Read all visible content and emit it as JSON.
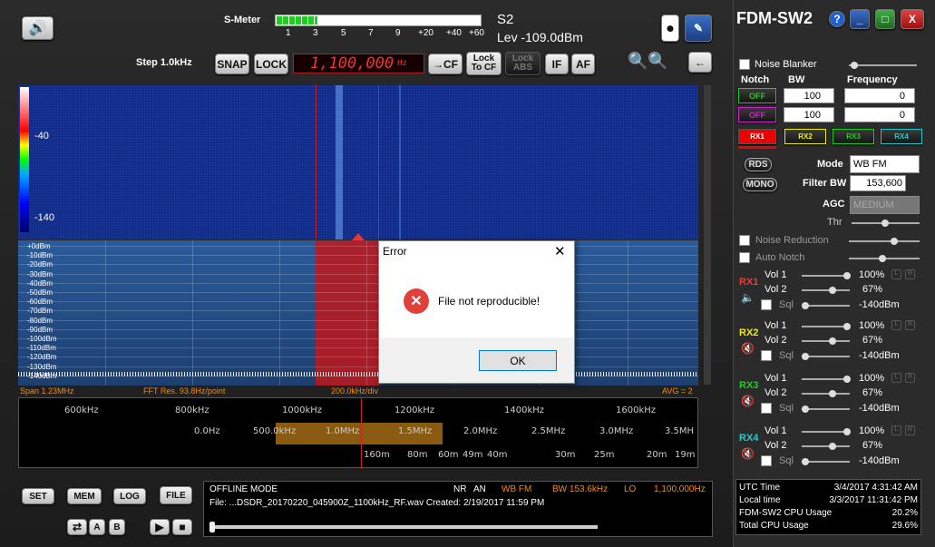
{
  "app": {
    "title": "FDM-SW2"
  },
  "smeter": {
    "label": "S-Meter",
    "ticks": [
      "1",
      "3",
      "5",
      "7",
      "9",
      "+20",
      "+40",
      "+60"
    ],
    "s_value": "S2",
    "level": "Lev -109.0dBm",
    "fill_fraction": 0.2
  },
  "toolbar": {
    "step": "Step 1.0kHz",
    "snap": "SNAP",
    "lock": "LOCK",
    "frequency": "1,100,000",
    "hz": "Hz",
    "to_cf": "→CF",
    "lock_to_cf": "Lock To CF",
    "lock_abs": "Lock ABS",
    "if": "IF",
    "af": "AF"
  },
  "waterfall": {
    "scale_top": "-40",
    "scale_bottom": "-140"
  },
  "spectrum": {
    "db_labels": [
      "+0dBm",
      "-10dBm",
      "-20dBm",
      "-30dBm",
      "-40dBm",
      "-50dBm",
      "-60dBm",
      "-70dBm",
      "-80dBm",
      "-90dBm",
      "-100dBm",
      "-110dBm",
      "-120dBm",
      "-130dBm",
      "-140dBm"
    ],
    "span": "Span 1.23MHz",
    "fft": "FFT Res. 93.8Hz/point",
    "div": "200.0kHz/div",
    "avg": "AVG = 2"
  },
  "scale": {
    "khz": [
      "600kHz",
      "800kHz",
      "1000kHz",
      "1200kHz",
      "1400kHz",
      "1600kHz"
    ],
    "mhz": [
      "0.0Hz",
      "500.0kHz",
      "1.0MHz",
      "1.5MHz",
      "2.0MHz",
      "2.5MHz",
      "3.0MHz",
      "3.5MH"
    ],
    "meters": [
      "160m",
      "80m",
      "60m",
      "49m",
      "40m",
      "30m",
      "25m",
      "20m",
      "19m"
    ]
  },
  "dialog": {
    "title": "Error",
    "message": "File not reproducible!",
    "ok": "OK"
  },
  "bottom": {
    "set": "SET",
    "mem": "MEM",
    "log": "LOG",
    "file": "FILE",
    "a": "A",
    "b": "B"
  },
  "status": {
    "mode_line": "OFFLINE MODE",
    "nr": "NR",
    "an": "AN",
    "wbfm": "WB FM",
    "bw": "BW 153.6kHz",
    "lo": "LO",
    "lo_val": "1,100,000Hz",
    "file": "File: ...DSDR_20170220_045900Z_1100kHz_RF.wav Created: 2/19/2017 11:59 PM"
  },
  "right": {
    "noise_blanker": "Noise Blanker",
    "notch": "Notch",
    "bw": "BW",
    "frequency": "Frequency",
    "off1": "OFF",
    "off2": "OFF",
    "bw1": "100",
    "bw2": "100",
    "f1": "0",
    "f2": "0",
    "rx": [
      "RX1",
      "RX2",
      "RX3",
      "RX4"
    ],
    "rds": "RDS",
    "mono": "MONO",
    "mode_label": "Mode",
    "mode": "WB FM",
    "filter_label": "Filter BW",
    "filter": "153,600",
    "agc_label": "AGC",
    "agc": "MEDIUM",
    "thr": "Thr",
    "noise_reduction": "Noise Reduction",
    "auto_notch": "Auto Notch",
    "vol1": "Vol 1",
    "vol2": "Vol 2",
    "sql": "Sql",
    "v1": "100%",
    "v2": "67%",
    "sqv": "-140dBm"
  },
  "info": {
    "utc_label": "UTC Time",
    "utc": "3/4/2017 4:31:42 AM",
    "local_label": "Local time",
    "local": "3/3/2017 11:31:42 PM",
    "cpu_label": "FDM-SW2 CPU Usage",
    "cpu": "20.2%",
    "total_label": "Total CPU Usage",
    "total": "29.6%"
  }
}
